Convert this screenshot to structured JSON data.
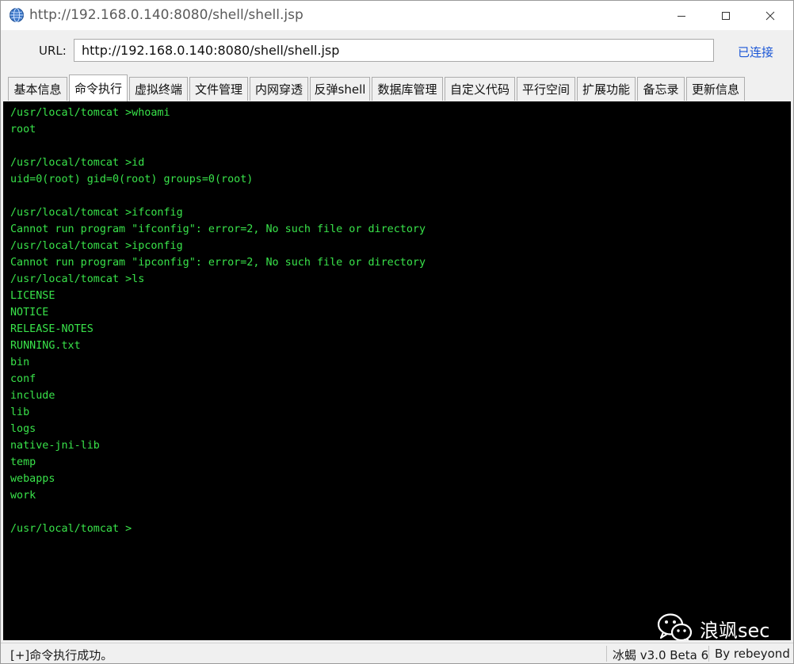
{
  "window": {
    "title": "http://192.168.0.140:8080/shell/shell.jsp",
    "controls": [
      "minimize",
      "maximize",
      "close"
    ]
  },
  "urlbar": {
    "label": "URL:",
    "value": "http://192.168.0.140:8080/shell/shell.jsp",
    "status": "已连接"
  },
  "tabs": [
    {
      "label": "基本信息",
      "active": false
    },
    {
      "label": "命令执行",
      "active": true
    },
    {
      "label": "虚拟终端",
      "active": false
    },
    {
      "label": "文件管理",
      "active": false
    },
    {
      "label": "内网穿透",
      "active": false
    },
    {
      "label": "反弹shell",
      "active": false
    },
    {
      "label": "数据库管理",
      "active": false
    },
    {
      "label": "自定义代码",
      "active": false
    },
    {
      "label": "平行空间",
      "active": false
    },
    {
      "label": "扩展功能",
      "active": false
    },
    {
      "label": "备忘录",
      "active": false
    },
    {
      "label": "更新信息",
      "active": false
    }
  ],
  "terminal": {
    "text_color": "#39e34a",
    "background": "#000000",
    "lines": [
      "/usr/local/tomcat >whoami",
      "root",
      "",
      "/usr/local/tomcat >id",
      "uid=0(root) gid=0(root) groups=0(root)",
      "",
      "/usr/local/tomcat >ifconfig",
      "Cannot run program \"ifconfig\": error=2, No such file or directory",
      "/usr/local/tomcat >ipconfig",
      "Cannot run program \"ipconfig\": error=2, No such file or directory",
      "/usr/local/tomcat >ls",
      "LICENSE",
      "NOTICE",
      "RELEASE-NOTES",
      "RUNNING.txt",
      "bin",
      "conf",
      "include",
      "lib",
      "logs",
      "native-jni-lib",
      "temp",
      "webapps",
      "work",
      "",
      "/usr/local/tomcat >"
    ]
  },
  "watermark": {
    "icon": "wechat-icon",
    "text": "浪飒sec"
  },
  "statusbar": {
    "message": "[+]命令执行成功。",
    "version": "冰蝎 v3.0 Beta 6",
    "author": "By rebeyond"
  }
}
